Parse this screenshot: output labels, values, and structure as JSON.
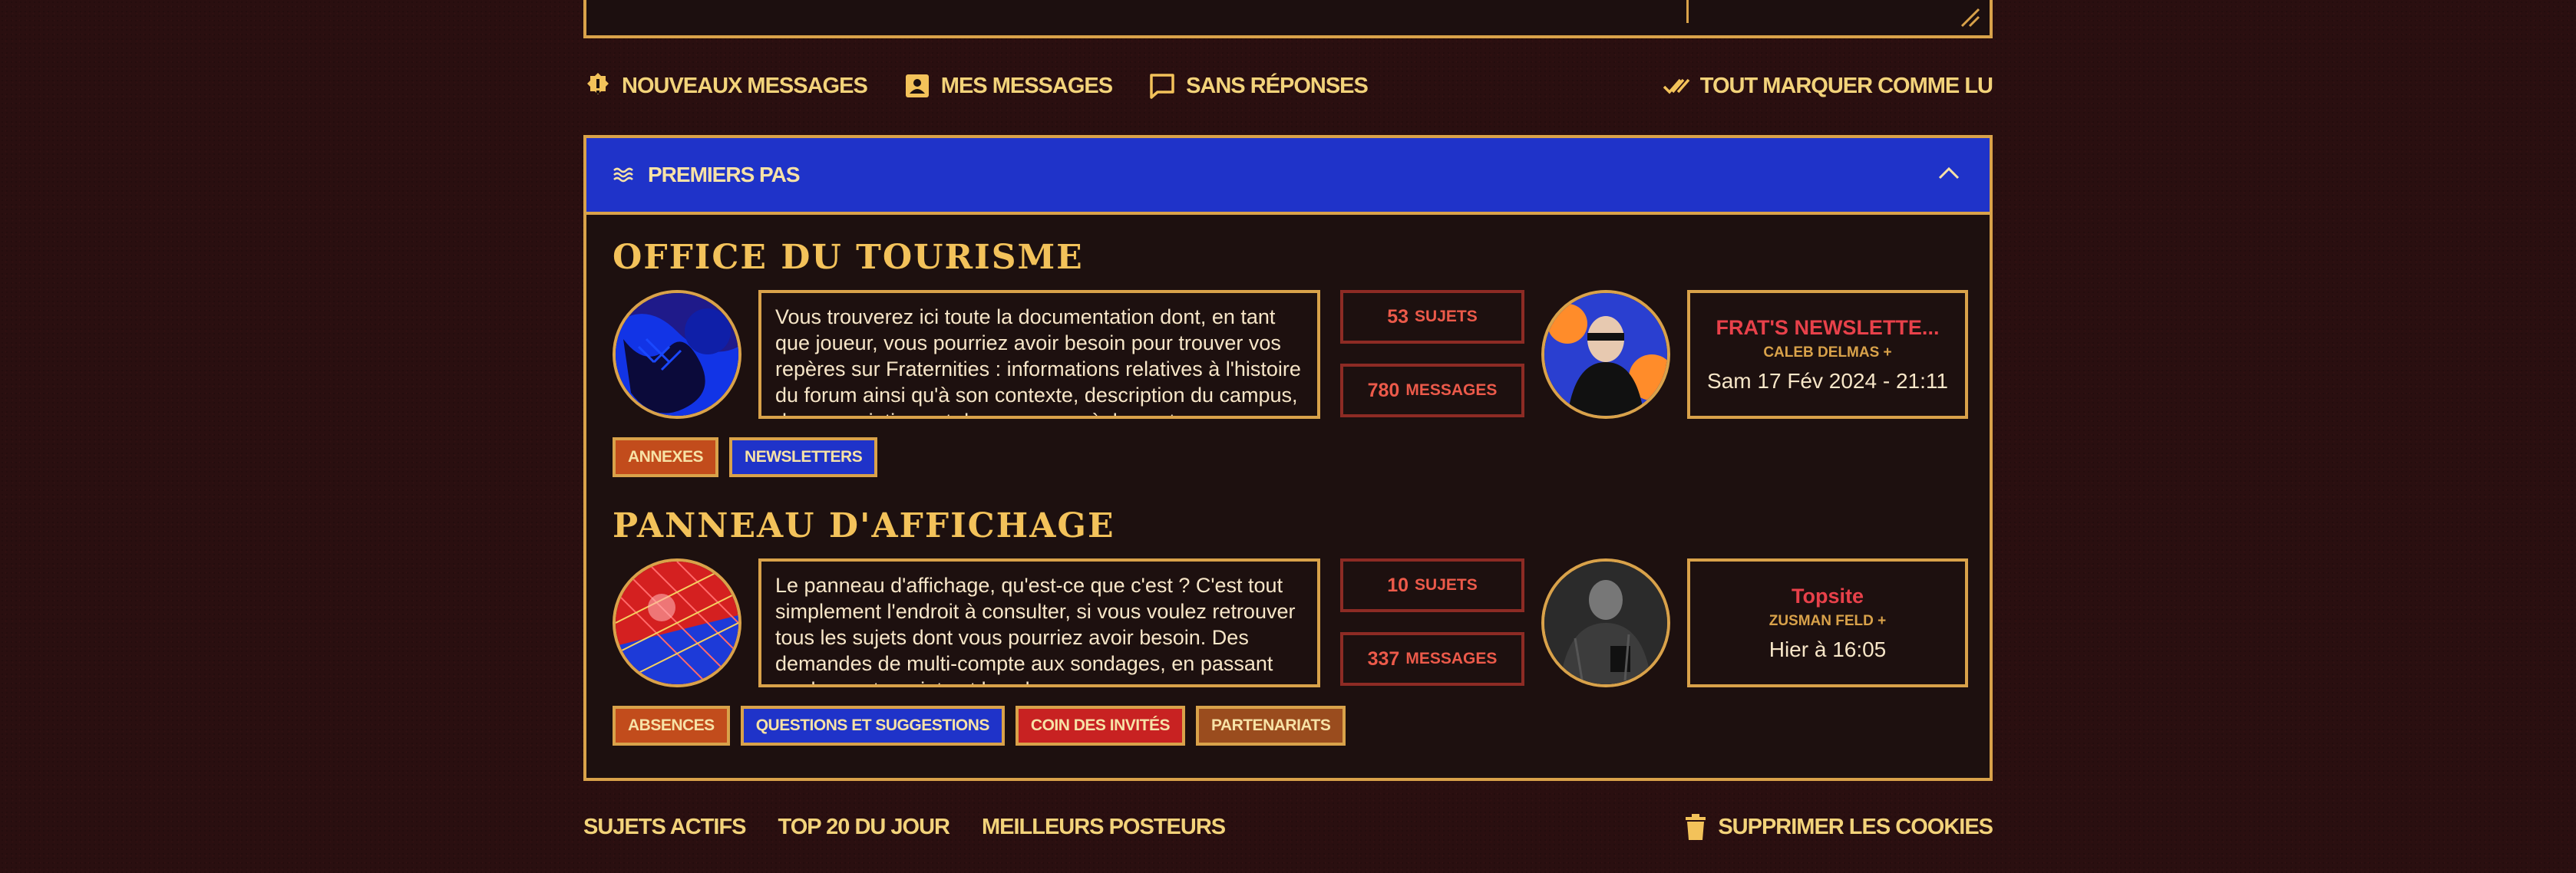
{
  "quick_links": {
    "new_messages": "NOUVEAUX MESSAGES",
    "my_messages": "MES MESSAGES",
    "unanswered": "SANS RÉPONSES",
    "mark_all_read": "TOUT MARQUER COMME LU"
  },
  "category": {
    "title": "PREMIERS PAS",
    "icons": {
      "menu": "waves-icon",
      "collapse": "chevron-up-icon"
    }
  },
  "forums": [
    {
      "title": "OFFICE DU TOURISME",
      "description": "Vous trouverez ici toute la documentation dont, en tant que joueur, vous pourriez avoir besoin pour trouver vos repères sur Fraternities : informations relatives à l'histoire du forum ainsi qu'à son contexte, description du campus, des associations et des groupes, règlement...",
      "topics_count": "53",
      "topics_label": "SUJETS",
      "messages_count": "780",
      "messages_label": "MESSAGES",
      "last_post_title": "FRAT'S NEWSLETTE...",
      "last_post_author": "CALEB DELMAS +",
      "last_post_date": "Sam 17 Fév 2024 - 21:11",
      "subforums": [
        "ANNEXES",
        "NEWSLETTERS"
      ]
    },
    {
      "title": "PANNEAU D'AFFICHAGE",
      "description": "Le panneau d'affichage, qu'est-ce que c'est ? C'est tout simplement l'endroit à consulter, si vous voulez retrouver tous les sujets dont vous pourriez avoir besoin. Des demandes de multi-compte aux sondages, en passant par les partenariats et les absences...",
      "topics_count": "10",
      "topics_label": "SUJETS",
      "messages_count": "337",
      "messages_label": "MESSAGES",
      "last_post_title": "Topsite",
      "last_post_author": "ZUSMAN FELD +",
      "last_post_date": "Hier à 16:05",
      "subforums": [
        "ABSENCES",
        "QUESTIONS ET SUGGESTIONS",
        "COIN DES INVITÉS",
        "PARTENARIATS"
      ]
    }
  ],
  "footer": {
    "active_topics": "SUJETS ACTIFS",
    "top20": "TOP 20 DU JOUR",
    "best_posters": "MEILLEURS POSTEURS",
    "delete_cookies": "SUPPRIMER LES COOKIES"
  },
  "colors": {
    "background": "#2a0f10",
    "accent_gold": "#d9a24a",
    "category_blue": "#1f33c9",
    "stat_red": "#ec5a4a",
    "last_title_red": "#e8414a"
  }
}
